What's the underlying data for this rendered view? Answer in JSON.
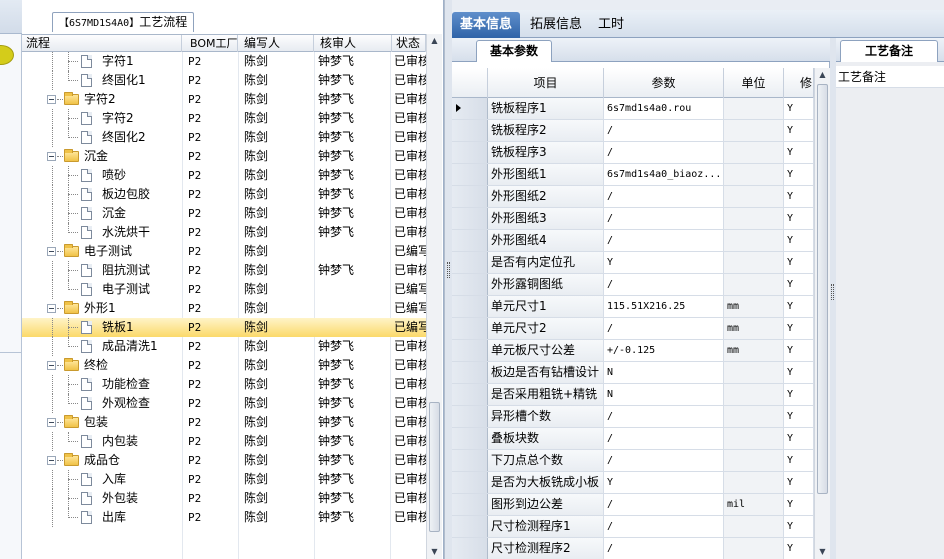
{
  "tree_panel": {
    "tab_label": "工艺流程",
    "tab_code": "【6S7MD1S4A0】",
    "columns": [
      "流程",
      "BOM工厂",
      "编写人",
      "核审人",
      "状态"
    ],
    "rows": [
      {
        "name": "字符1",
        "kind": "doc",
        "level": 2,
        "bom": "P2",
        "author": "陈剑",
        "reviewer": "钟梦飞",
        "status": "已审核"
      },
      {
        "name": "终固化1",
        "kind": "doc",
        "level": 2,
        "bom": "P2",
        "author": "陈剑",
        "reviewer": "钟梦飞",
        "status": "已审核"
      },
      {
        "name": "字符2",
        "kind": "folder",
        "level": 1,
        "bom": "P2",
        "author": "陈剑",
        "reviewer": "钟梦飞",
        "status": "已审核"
      },
      {
        "name": "字符2",
        "kind": "doc",
        "level": 2,
        "bom": "P2",
        "author": "陈剑",
        "reviewer": "钟梦飞",
        "status": "已审核"
      },
      {
        "name": "终固化2",
        "kind": "doc",
        "level": 2,
        "bom": "P2",
        "author": "陈剑",
        "reviewer": "钟梦飞",
        "status": "已审核"
      },
      {
        "name": "沉金",
        "kind": "folder",
        "level": 1,
        "bom": "P2",
        "author": "陈剑",
        "reviewer": "钟梦飞",
        "status": "已审核"
      },
      {
        "name": "喷砂",
        "kind": "doc",
        "level": 2,
        "bom": "P2",
        "author": "陈剑",
        "reviewer": "钟梦飞",
        "status": "已审核"
      },
      {
        "name": "板边包胶",
        "kind": "doc",
        "level": 2,
        "bom": "P2",
        "author": "陈剑",
        "reviewer": "钟梦飞",
        "status": "已审核"
      },
      {
        "name": "沉金",
        "kind": "doc",
        "level": 2,
        "bom": "P2",
        "author": "陈剑",
        "reviewer": "钟梦飞",
        "status": "已审核"
      },
      {
        "name": "水洗烘干",
        "kind": "doc",
        "level": 2,
        "bom": "P2",
        "author": "陈剑",
        "reviewer": "钟梦飞",
        "status": "已审核"
      },
      {
        "name": "电子测试",
        "kind": "folder",
        "level": 1,
        "bom": "P2",
        "author": "陈剑",
        "reviewer": "",
        "status": "已编写"
      },
      {
        "name": "阻抗测试",
        "kind": "doc",
        "level": 2,
        "bom": "P2",
        "author": "陈剑",
        "reviewer": "钟梦飞",
        "status": "已审核"
      },
      {
        "name": "电子测试",
        "kind": "doc",
        "level": 2,
        "bom": "P2",
        "author": "陈剑",
        "reviewer": "",
        "status": "已编写"
      },
      {
        "name": "外形1",
        "kind": "folder",
        "level": 1,
        "bom": "P2",
        "author": "陈剑",
        "reviewer": "",
        "status": "已编写"
      },
      {
        "name": "铣板1",
        "kind": "doc",
        "level": 2,
        "bom": "P2",
        "author": "陈剑",
        "reviewer": "",
        "status": "已编写",
        "selected": true
      },
      {
        "name": "成品清洗1",
        "kind": "doc",
        "level": 2,
        "bom": "P2",
        "author": "陈剑",
        "reviewer": "钟梦飞",
        "status": "已审核"
      },
      {
        "name": "终检",
        "kind": "folder",
        "level": 1,
        "bom": "P2",
        "author": "陈剑",
        "reviewer": "钟梦飞",
        "status": "已审核"
      },
      {
        "name": "功能检查",
        "kind": "doc",
        "level": 2,
        "bom": "P2",
        "author": "陈剑",
        "reviewer": "钟梦飞",
        "status": "已审核"
      },
      {
        "name": "外观检查",
        "kind": "doc",
        "level": 2,
        "bom": "P2",
        "author": "陈剑",
        "reviewer": "钟梦飞",
        "status": "已审核"
      },
      {
        "name": "包装",
        "kind": "folder",
        "level": 1,
        "bom": "P2",
        "author": "陈剑",
        "reviewer": "钟梦飞",
        "status": "已审核"
      },
      {
        "name": "内包装",
        "kind": "doc",
        "level": 2,
        "bom": "P2",
        "author": "陈剑",
        "reviewer": "钟梦飞",
        "status": "已审核"
      },
      {
        "name": "成品仓",
        "kind": "folder",
        "level": 1,
        "bom": "P2",
        "author": "陈剑",
        "reviewer": "钟梦飞",
        "status": "已审核"
      },
      {
        "name": "入库",
        "kind": "doc",
        "level": 2,
        "bom": "P2",
        "author": "陈剑",
        "reviewer": "钟梦飞",
        "status": "已审核"
      },
      {
        "name": "外包装",
        "kind": "doc",
        "level": 2,
        "bom": "P2",
        "author": "陈剑",
        "reviewer": "钟梦飞",
        "status": "已审核"
      },
      {
        "name": "出库",
        "kind": "doc",
        "level": 2,
        "bom": "P2",
        "author": "陈剑",
        "reviewer": "钟梦飞",
        "status": "已审核"
      }
    ]
  },
  "main_tabs": [
    {
      "label": "基本信息",
      "active": true
    },
    {
      "label": "拓展信息",
      "active": false
    },
    {
      "label": "工时",
      "active": false
    }
  ],
  "info_panel": {
    "subtab_label": "基本参数",
    "columns": [
      "项目",
      "参数",
      "单位",
      "修"
    ],
    "rows": [
      {
        "item": "铣板程序1",
        "param": "6s7md1s4a0.rou",
        "unit": "",
        "flag": "Y",
        "current": true
      },
      {
        "item": "铣板程序2",
        "param": "/",
        "unit": "",
        "flag": "Y"
      },
      {
        "item": "铣板程序3",
        "param": "/",
        "unit": "",
        "flag": "Y"
      },
      {
        "item": "外形图纸1",
        "param": "6s7md1s4a0_biaoz...",
        "unit": "",
        "flag": "Y"
      },
      {
        "item": "外形图纸2",
        "param": "/",
        "unit": "",
        "flag": "Y"
      },
      {
        "item": "外形图纸3",
        "param": "/",
        "unit": "",
        "flag": "Y"
      },
      {
        "item": "外形图纸4",
        "param": "/",
        "unit": "",
        "flag": "Y"
      },
      {
        "item": "是否有内定位孔",
        "param": "Y",
        "unit": "",
        "flag": "Y"
      },
      {
        "item": "外形露铜图纸",
        "param": "/",
        "unit": "",
        "flag": "Y"
      },
      {
        "item": "单元尺寸1",
        "param": "115.51X216.25",
        "unit": "mm",
        "flag": "Y"
      },
      {
        "item": "单元尺寸2",
        "param": "/",
        "unit": "mm",
        "flag": "Y"
      },
      {
        "item": "单元板尺寸公差",
        "param": "+/-0.125",
        "unit": "mm",
        "flag": "Y"
      },
      {
        "item": "板边是否有钻槽设计",
        "param": "N",
        "unit": "",
        "flag": "Y"
      },
      {
        "item": "是否采用粗铣+精铣",
        "param": "N",
        "unit": "",
        "flag": "Y"
      },
      {
        "item": "异形槽个数",
        "param": "/",
        "unit": "",
        "flag": "Y"
      },
      {
        "item": "叠板块数",
        "param": "/",
        "unit": "",
        "flag": "Y"
      },
      {
        "item": "下刀点总个数",
        "param": "/",
        "unit": "",
        "flag": "Y"
      },
      {
        "item": "是否为大板铣成小板",
        "param": "Y",
        "unit": "",
        "flag": "Y"
      },
      {
        "item": "图形到边公差",
        "param": "/",
        "unit": "mil",
        "flag": "Y"
      },
      {
        "item": "尺寸检测程序1",
        "param": "/",
        "unit": "",
        "flag": "Y"
      },
      {
        "item": "尺寸检测程序2",
        "param": "/",
        "unit": "",
        "flag": "Y"
      }
    ]
  },
  "remark_panel": {
    "tab_label": "工艺备注",
    "field_label": "工艺备注"
  }
}
